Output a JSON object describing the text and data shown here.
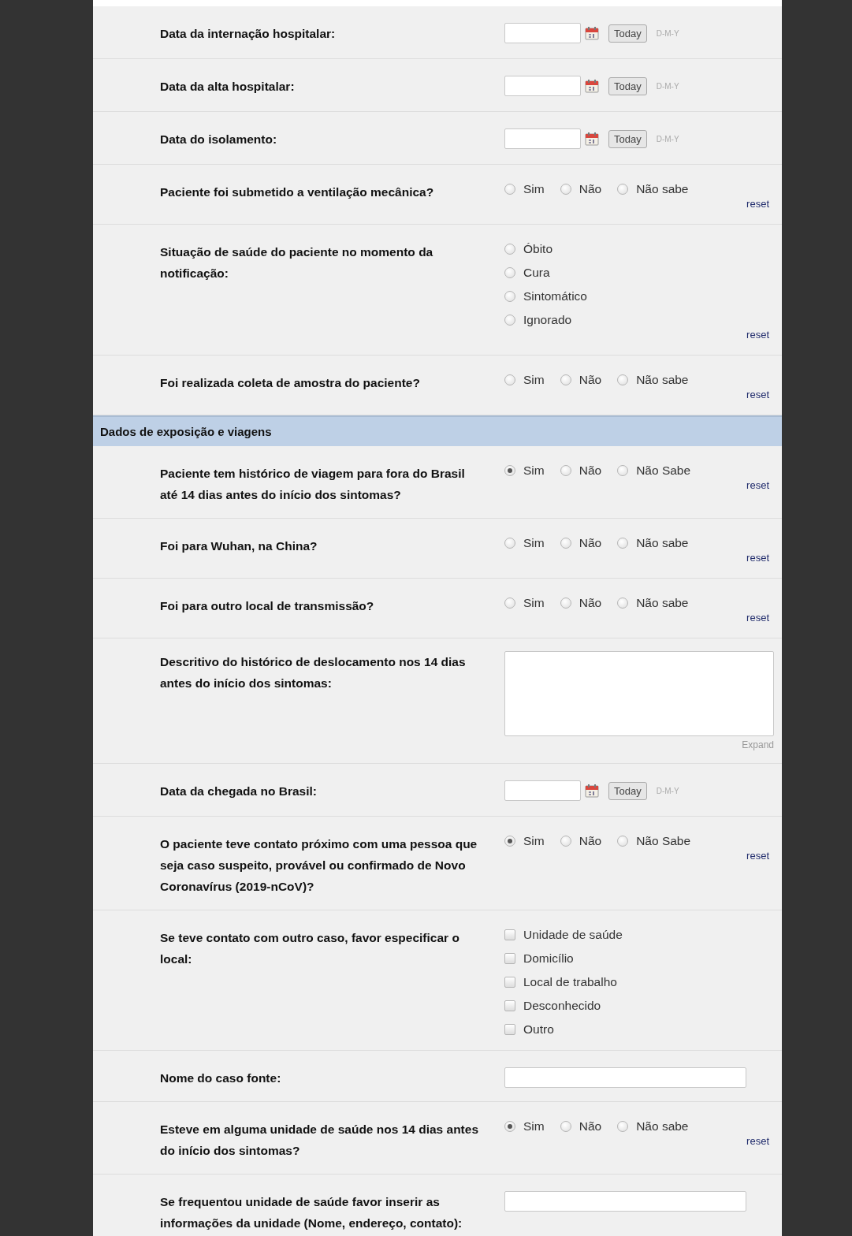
{
  "rows": [
    {
      "kind": "date",
      "label": "Data da internação hospitalar:",
      "button": "Today",
      "format": "D-M-Y"
    },
    {
      "kind": "date",
      "label": "Data da alta hospitalar:",
      "button": "Today",
      "format": "D-M-Y"
    },
    {
      "kind": "date",
      "label": "Data do isolamento:",
      "button": "Today",
      "format": "D-M-Y"
    },
    {
      "kind": "radio_inline",
      "label": "Paciente foi submetido a ventilação mecânica?",
      "options": [
        {
          "label": "Sim",
          "selected": false
        },
        {
          "label": "Não",
          "selected": false
        },
        {
          "label": "Não sabe",
          "selected": false
        }
      ],
      "reset": "reset"
    },
    {
      "kind": "radio_stack",
      "label": "Situação de saúde do paciente no momento da notificação:",
      "options": [
        {
          "label": "Óbito",
          "selected": false
        },
        {
          "label": "Cura",
          "selected": false
        },
        {
          "label": "Sintomático",
          "selected": false
        },
        {
          "label": "Ignorado",
          "selected": false
        }
      ],
      "reset": "reset"
    },
    {
      "kind": "radio_inline",
      "label": "Foi realizada coleta de amostra do paciente?",
      "options": [
        {
          "label": "Sim",
          "selected": false
        },
        {
          "label": "Não",
          "selected": false
        },
        {
          "label": "Não sabe",
          "selected": false
        }
      ],
      "reset": "reset"
    },
    {
      "kind": "section",
      "label": "Dados de exposição e viagens"
    },
    {
      "kind": "radio_inline",
      "label": "Paciente tem histórico de viagem para fora do Brasil até 14 dias antes do início dos sintomas?",
      "options": [
        {
          "label": "Sim",
          "selected": true
        },
        {
          "label": "Não",
          "selected": false
        },
        {
          "label": "Não Sabe",
          "selected": false
        }
      ],
      "reset": "reset"
    },
    {
      "kind": "radio_inline",
      "label": "Foi para Wuhan, na China?",
      "options": [
        {
          "label": "Sim",
          "selected": false
        },
        {
          "label": "Não",
          "selected": false
        },
        {
          "label": "Não sabe",
          "selected": false
        }
      ],
      "reset": "reset"
    },
    {
      "kind": "radio_inline",
      "label": "Foi para outro local de transmissão?",
      "options": [
        {
          "label": "Sim",
          "selected": false
        },
        {
          "label": "Não",
          "selected": false
        },
        {
          "label": "Não sabe",
          "selected": false
        }
      ],
      "reset": "reset"
    },
    {
      "kind": "textarea",
      "label": "Descritivo do histórico de deslocamento nos 14 dias antes do início dos sintomas:",
      "expand": "Expand"
    },
    {
      "kind": "date",
      "label": "Data da chegada no Brasil:",
      "button": "Today",
      "format": "D-M-Y"
    },
    {
      "kind": "radio_inline",
      "label": "O paciente teve contato próximo com uma pessoa que seja caso suspeito, provável ou confirmado de Novo Coronavírus (2019-nCoV)?",
      "options": [
        {
          "label": "Sim",
          "selected": true
        },
        {
          "label": "Não",
          "selected": false
        },
        {
          "label": "Não Sabe",
          "selected": false
        }
      ],
      "reset": "reset"
    },
    {
      "kind": "checkbox_stack",
      "label": "Se teve contato com outro caso, favor especificar o local:",
      "options": [
        {
          "label": "Unidade de saúde",
          "checked": false
        },
        {
          "label": "Domicílio",
          "checked": false
        },
        {
          "label": "Local de trabalho",
          "checked": false
        },
        {
          "label": "Desconhecido",
          "checked": false
        },
        {
          "label": "Outro",
          "checked": false
        }
      ]
    },
    {
      "kind": "text",
      "label": "Nome do caso fonte:"
    },
    {
      "kind": "radio_inline",
      "label": "Esteve em alguma unidade de saúde nos 14 dias antes do início dos sintomas?",
      "options": [
        {
          "label": "Sim",
          "selected": true
        },
        {
          "label": "Não",
          "selected": false
        },
        {
          "label": "Não sabe",
          "selected": false
        }
      ],
      "reset": "reset"
    },
    {
      "kind": "text",
      "label": "Se frequentou unidade de saúde favor inserir as informações da unidade (Nome, endereço, contato):"
    }
  ]
}
